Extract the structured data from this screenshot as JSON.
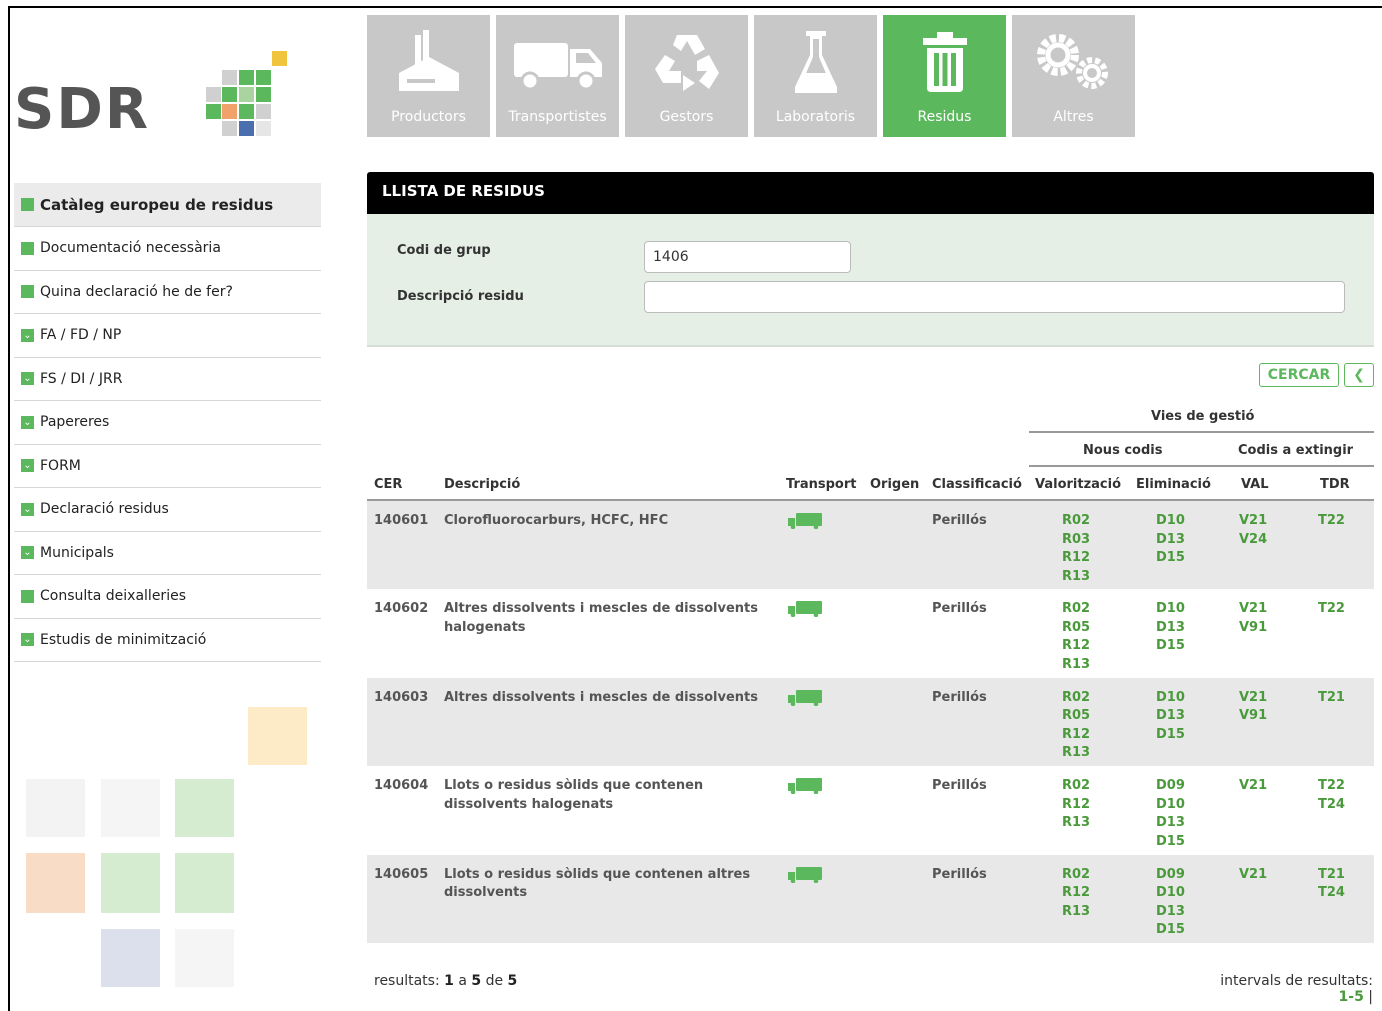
{
  "logo": {
    "text": "SDR"
  },
  "sidebar": {
    "items": [
      {
        "label": "Catàleg europeu de residus",
        "icon": "square-icon"
      },
      {
        "label": "Documentació necessària",
        "icon": "square-icon"
      },
      {
        "label": "Quina declaració he de fer?",
        "icon": "square-icon"
      },
      {
        "label": "FA / FD / NP",
        "icon": "chevron-down-icon"
      },
      {
        "label": "FS / DI / JRR",
        "icon": "chevron-down-icon"
      },
      {
        "label": "Papereres",
        "icon": "chevron-down-icon"
      },
      {
        "label": "FORM",
        "icon": "chevron-down-icon"
      },
      {
        "label": "Declaració residus",
        "icon": "chevron-down-icon"
      },
      {
        "label": "Municipals",
        "icon": "chevron-down-icon"
      },
      {
        "label": "Consulta deixalleries",
        "icon": "square-icon"
      },
      {
        "label": "Estudis de minimització",
        "icon": "chevron-down-icon"
      }
    ]
  },
  "tabs": [
    {
      "label": "Productors",
      "icon": "factory-icon"
    },
    {
      "label": "Transportistes",
      "icon": "truck-icon"
    },
    {
      "label": "Gestors",
      "icon": "recycle-icon"
    },
    {
      "label": "Laboratoris",
      "icon": "flask-icon"
    },
    {
      "label": "Residus",
      "icon": "trash-icon"
    },
    {
      "label": "Altres",
      "icon": "gears-icon"
    }
  ],
  "panel": {
    "title": "LLISTA DE RESIDUS",
    "group_code_label": "Codi de grup",
    "group_code_value": "1406",
    "description_label": "Descripció residu",
    "description_value": ""
  },
  "actions": {
    "search_label": "CERCAR"
  },
  "table": {
    "group_header": "Vies de gestió",
    "sub_new": "Nous codis",
    "sub_extinct": "Codis a extingir",
    "columns": [
      "CER",
      "Descripció",
      "Transport",
      "Origen",
      "Classificació",
      "Valorització",
      "Eliminació",
      "VAL",
      "TDR"
    ],
    "rows": [
      {
        "cer": "140601",
        "desc": "Clorofluorocarburs, HCFC, HFC",
        "origin": "",
        "class": "Perillós",
        "val": [
          "R02",
          "R03",
          "R12",
          "R13"
        ],
        "elim": [
          "D10",
          "D13",
          "D15"
        ],
        "v": [
          "V21",
          "V24"
        ],
        "t": [
          "T22"
        ]
      },
      {
        "cer": "140602",
        "desc": "Altres dissolvents i mescles de dissolvents halogenats",
        "origin": "",
        "class": "Perillós",
        "val": [
          "R02",
          "R05",
          "R12",
          "R13"
        ],
        "elim": [
          "D10",
          "D13",
          "D15"
        ],
        "v": [
          "V21",
          "V91"
        ],
        "t": [
          "T22"
        ]
      },
      {
        "cer": "140603",
        "desc": "Altres dissolvents i mescles de dissolvents",
        "origin": "",
        "class": "Perillós",
        "val": [
          "R02",
          "R05",
          "R12",
          "R13"
        ],
        "elim": [
          "D10",
          "D13",
          "D15"
        ],
        "v": [
          "V21",
          "V91"
        ],
        "t": [
          "T21"
        ]
      },
      {
        "cer": "140604",
        "desc": "Llots o residus sòlids que contenen dissolvents halogenats",
        "origin": "",
        "class": "Perillós",
        "val": [
          "R02",
          "R12",
          "R13"
        ],
        "elim": [
          "D09",
          "D10",
          "D13",
          "D15"
        ],
        "v": [
          "V21"
        ],
        "t": [
          "T22",
          "T24"
        ]
      },
      {
        "cer": "140605",
        "desc": "Llots o residus sòlids que contenen altres dissolvents",
        "origin": "",
        "class": "Perillós",
        "val": [
          "R02",
          "R12",
          "R13"
        ],
        "elim": [
          "D09",
          "D10",
          "D13",
          "D15"
        ],
        "v": [
          "V21"
        ],
        "t": [
          "T21",
          "T24"
        ]
      }
    ]
  },
  "footer": {
    "results_prefix": "resultats:",
    "from": "1",
    "to_word": "a",
    "to": "5",
    "of_word": "de",
    "total": "5",
    "intervals_label": "intervals de resultats:",
    "interval_link": "1-5",
    "interval_sep": "|"
  },
  "colors": {
    "accent": "#5cb85c",
    "tab_inactive": "#c8c8c8",
    "code_green": "#4a9a3c",
    "panel_bg": "#e6efe6"
  }
}
